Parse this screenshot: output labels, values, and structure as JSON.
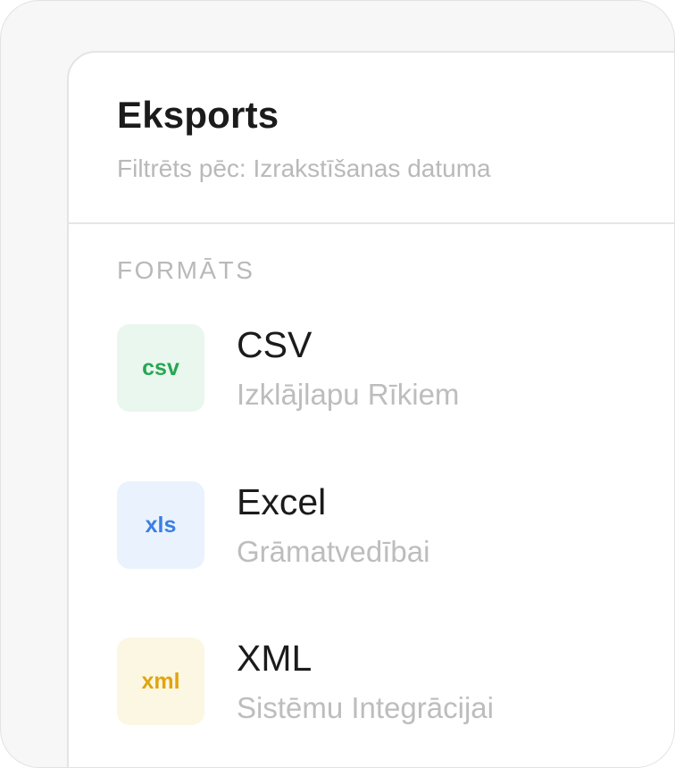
{
  "header": {
    "title": "Eksports",
    "subtitle": "Filtrēts pēc: Izrakstīšanas datuma"
  },
  "section": {
    "label": "FORMĀTS"
  },
  "formats": [
    {
      "badge": "csv",
      "title": "CSV",
      "description": "Izklājlapu Rīkiem",
      "badge_bg": "#e9f7ee",
      "badge_color": "#27a653",
      "icon": "csv-file-icon"
    },
    {
      "badge": "xls",
      "title": "Excel",
      "description": "Grāmatvedībai",
      "badge_bg": "#eaf2fd",
      "badge_color": "#3a7fe3",
      "icon": "xls-file-icon"
    },
    {
      "badge": "xml",
      "title": "XML",
      "description": "Sistēmu Integrācijai",
      "badge_bg": "#fcf7e3",
      "badge_color": "#e0a50f",
      "icon": "xml-file-icon"
    }
  ]
}
